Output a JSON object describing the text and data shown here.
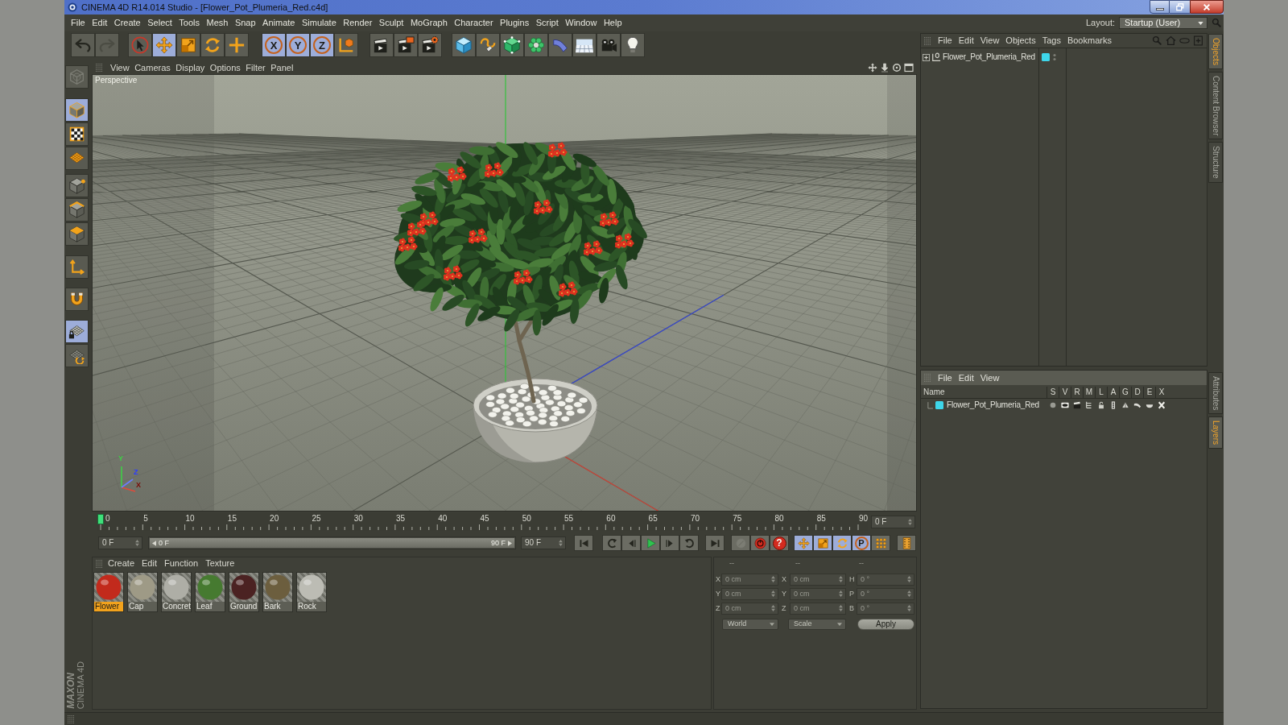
{
  "window": {
    "title": "CINEMA 4D R14.014 Studio - [Flower_Pot_Plumeria_Red.c4d]"
  },
  "menu_bar": {
    "items": [
      "File",
      "Edit",
      "Create",
      "Select",
      "Tools",
      "Mesh",
      "Snap",
      "Animate",
      "Simulate",
      "Render",
      "Sculpt",
      "MoGraph",
      "Character",
      "Plugins",
      "Script",
      "Window",
      "Help"
    ],
    "layout_label": "Layout:",
    "layout_value": "Startup (User)"
  },
  "toolbar": [
    {
      "selected": false,
      "disabled": false
    },
    {
      "selected": false,
      "disabled": true
    },
    {
      "selected": false,
      "disabled": false
    },
    {
      "selected": true,
      "disabled": false
    },
    {
      "selected": false,
      "disabled": false
    },
    {
      "selected": false,
      "disabled": false
    },
    {
      "selected": false,
      "disabled": false
    },
    {
      "label": "X",
      "selected": true,
      "disabled": false
    },
    {
      "label": "Y",
      "selected": true,
      "disabled": false
    },
    {
      "label": "Z",
      "selected": true,
      "disabled": false
    },
    {
      "selected": false,
      "disabled": false
    },
    {
      "selected": false,
      "disabled": false
    },
    {
      "selected": false,
      "disabled": false
    },
    {
      "selected": false,
      "disabled": false
    },
    {
      "selected": false,
      "disabled": false
    },
    {
      "selected": false,
      "disabled": false
    },
    {
      "selected": false,
      "disabled": false
    },
    {
      "selected": false,
      "disabled": false
    },
    {
      "selected": false,
      "disabled": false
    },
    {
      "selected": false,
      "disabled": false
    },
    {
      "selected": false,
      "disabled": false
    },
    {
      "selected": false,
      "disabled": false
    }
  ],
  "mode_toolbar": [
    {
      "selected": false,
      "disabled": true
    },
    {
      "selected": true,
      "disabled": false
    },
    {
      "selected": false,
      "disabled": false
    },
    {
      "selected": false,
      "disabled": false
    },
    {
      "selected": false,
      "disabled": false
    },
    {
      "selected": false,
      "disabled": false
    },
    {
      "selected": false,
      "disabled": false
    },
    {
      "selected": false,
      "disabled": false
    },
    {
      "selected": false,
      "disabled": false
    },
    {
      "selected": true,
      "disabled": false
    },
    {
      "selected": false,
      "disabled": false
    }
  ],
  "viewport": {
    "menu": [
      "View",
      "Cameras",
      "Display",
      "Options",
      "Filter",
      "Panel"
    ],
    "camera": "Perspective",
    "axis_labels": [
      "Y",
      "Z",
      "X"
    ]
  },
  "timeline": {
    "frame_labels": [
      "0",
      "5",
      "10",
      "15",
      "20",
      "25",
      "30",
      "35",
      "40",
      "45",
      "50",
      "55",
      "60",
      "65",
      "70",
      "75",
      "80",
      "85",
      "90"
    ],
    "playhead": {
      "level": 0
    },
    "current_frame": "0 F"
  },
  "transport": {
    "start_frame": "0 F",
    "range": {
      "start": "0 F",
      "end": "90 F",
      "level": 1
    },
    "end_frame": "90 F",
    "buttons": [
      {
        "selected": false,
        "disabled": false
      },
      {
        "selected": false,
        "disabled": false
      },
      {
        "selected": false,
        "disabled": false
      },
      {
        "selected": false,
        "disabled": false
      },
      {
        "selected": false,
        "disabled": false
      },
      {
        "selected": false,
        "disabled": false
      },
      {
        "selected": false,
        "disabled": false
      },
      {
        "selected": false,
        "disabled": true
      },
      {
        "selected": false,
        "disabled": false
      },
      {
        "label": "?",
        "selected": false,
        "disabled": false
      },
      {
        "selected": true,
        "disabled": false
      },
      {
        "selected": true,
        "disabled": false
      },
      {
        "selected": true,
        "disabled": false
      },
      {
        "label": "P",
        "selected": true,
        "disabled": false
      },
      {
        "selected": false,
        "disabled": false
      },
      {
        "selected": false,
        "disabled": false
      }
    ]
  },
  "materials": {
    "menu": [
      "Create",
      "Edit",
      "Function",
      "Texture"
    ],
    "items": [
      {
        "name": "Flower",
        "selected": true,
        "color": "#c22a1c"
      },
      {
        "name": "Cap",
        "selected": false,
        "color": "#9e9a86"
      },
      {
        "name": "Concret",
        "selected": false,
        "color": "#aeaea6"
      },
      {
        "name": "Leaf",
        "selected": false,
        "color": "#467a30"
      },
      {
        "name": "Ground",
        "selected": false,
        "color": "#4b2222"
      },
      {
        "name": "Bark",
        "selected": false,
        "color": "#6c5e3e"
      },
      {
        "name": "Rock",
        "selected": false,
        "color": "#bcbcb4"
      }
    ]
  },
  "coordinates": {
    "header": [
      "--",
      "--",
      "--"
    ],
    "rows": [
      {
        "position_axis": "X",
        "position": "0 cm",
        "size_axis": "X",
        "size": "0 cm",
        "rotation_axis": "H",
        "rotation": "0 °"
      },
      {
        "position_axis": "Y",
        "position": "0 cm",
        "size_axis": "Y",
        "size": "0 cm",
        "rotation_axis": "P",
        "rotation": "0 °"
      },
      {
        "position_axis": "Z",
        "position": "0 cm",
        "size_axis": "Z",
        "size": "0 cm",
        "rotation_axis": "B",
        "rotation": "0 °"
      }
    ],
    "space": "World",
    "mode": "Scale",
    "apply": "Apply"
  },
  "objects_manager": {
    "menu": [
      "File",
      "Edit",
      "View",
      "Objects",
      "Tags",
      "Bookmarks"
    ],
    "objects": [
      {
        "name": "Flower_Pot_Plumeria_Red",
        "expanded": false,
        "color": "#3ed6ea"
      }
    ]
  },
  "side_tabs_top": [
    {
      "label": "Objects",
      "selected": true
    },
    {
      "label": "Content Browser",
      "selected": false
    },
    {
      "label": "Structure",
      "selected": false
    }
  ],
  "layer_manager": {
    "menu": [
      "File",
      "Edit",
      "View"
    ],
    "columns": [
      "Name",
      "S",
      "V",
      "R",
      "M",
      "L",
      "A",
      "G",
      "D",
      "E",
      "X"
    ],
    "layers": [
      {
        "name": "Flower_Pot_Plumeria_Red",
        "color": "#3ed6ea"
      }
    ]
  },
  "side_tabs_bottom": [
    {
      "label": "Attributes",
      "selected": false
    },
    {
      "label": "Layers",
      "selected": true
    }
  ],
  "logo": {
    "brand": "MAXON",
    "product": "CINEMA 4D"
  }
}
